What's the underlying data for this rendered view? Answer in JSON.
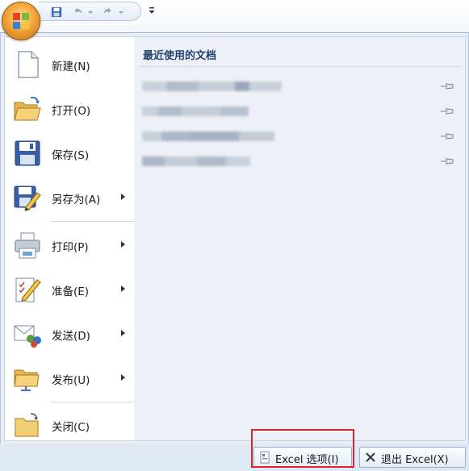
{
  "menu": {
    "items": [
      {
        "label": "新建(N)",
        "icon": "new-document-icon",
        "submenu": false
      },
      {
        "label": "打开(O)",
        "icon": "open-folder-icon",
        "submenu": false
      },
      {
        "label": "保存(S)",
        "icon": "save-disk-icon",
        "submenu": false
      },
      {
        "label": "另存为(A)",
        "icon": "save-as-icon",
        "submenu": true
      },
      {
        "label": "打印(P)",
        "icon": "printer-icon",
        "submenu": true
      },
      {
        "label": "准备(E)",
        "icon": "prepare-icon",
        "submenu": true
      },
      {
        "label": "发送(D)",
        "icon": "send-icon",
        "submenu": true
      },
      {
        "label": "发布(U)",
        "icon": "publish-icon",
        "submenu": true
      },
      {
        "label": "关闭(C)",
        "icon": "close-folder-icon",
        "submenu": false
      }
    ]
  },
  "recent": {
    "title": "最近使用的文档",
    "documents": [
      {
        "name": "",
        "pinned": false
      },
      {
        "name": "",
        "pinned": false
      },
      {
        "name": "",
        "pinned": false
      },
      {
        "name": "",
        "pinned": false
      }
    ]
  },
  "buttons": {
    "options_label": "Excel 选项(I)",
    "exit_label": "退出 Excel(X)"
  },
  "colors": {
    "accent": "#24406a",
    "highlight": "#e0242b",
    "pane_bg": "#edf1f7"
  }
}
